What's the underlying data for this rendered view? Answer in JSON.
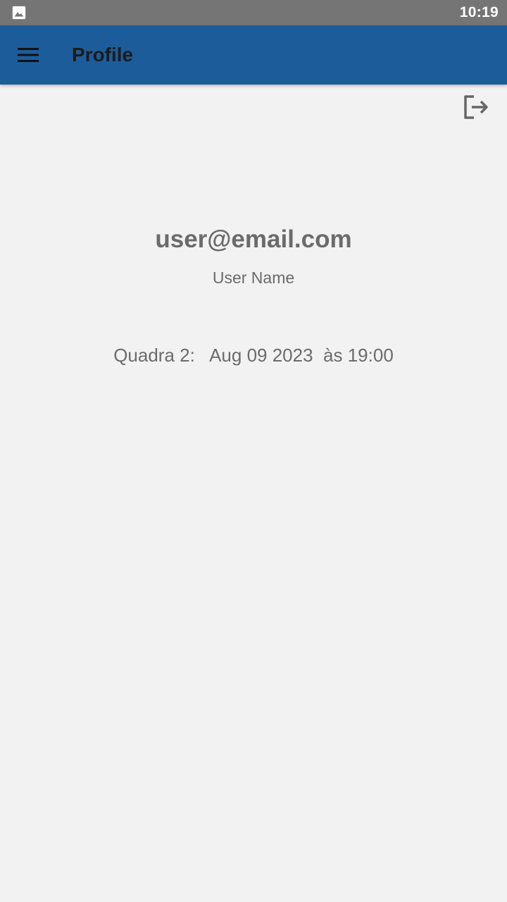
{
  "status_bar": {
    "time": "10:19",
    "notification_icon": "image-icon"
  },
  "app_bar": {
    "title": "Profile",
    "menu_icon": "hamburger-menu-icon",
    "color": "#1d5c9b"
  },
  "actions": {
    "logout_icon": "logout-icon"
  },
  "profile": {
    "email": "user@email.com",
    "name": "User Name"
  },
  "bookings": [
    {
      "court": "Quadra 2:",
      "date": "Aug 09 2023",
      "time_prefix": "às",
      "time": "19:00"
    }
  ],
  "colors": {
    "background": "#f2f2f2",
    "status_bar": "#757575",
    "text": "#6b6b6b"
  }
}
